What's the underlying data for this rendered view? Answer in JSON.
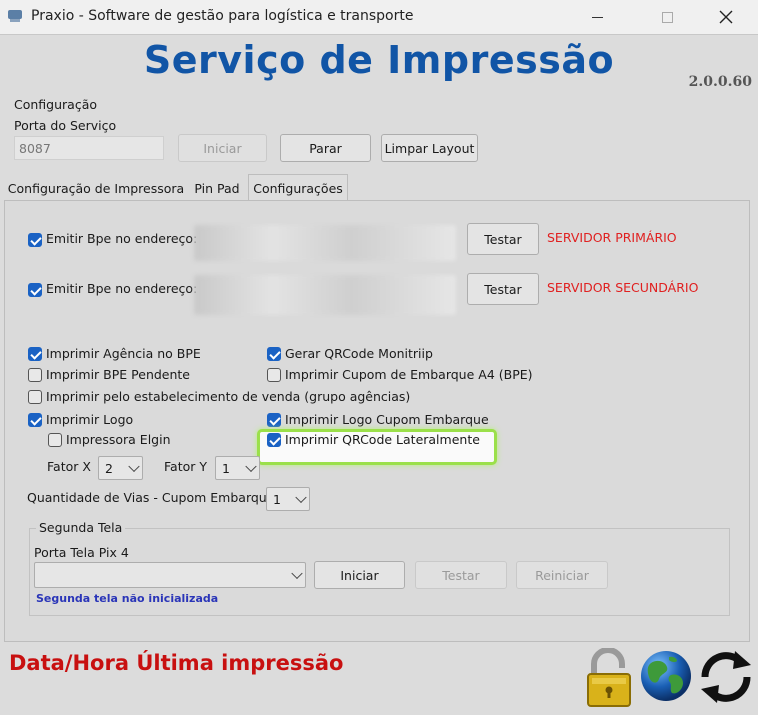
{
  "window": {
    "title": "Praxio - Software de gestão para logística e transporte",
    "minimize_icon": "minimize-icon",
    "maximize_icon": "maximize-icon",
    "close_icon": "close-icon"
  },
  "header": {
    "title": "Serviço de Impressão",
    "version": "2.0.0.60"
  },
  "config": {
    "group_label": "Configuração",
    "port_label": "Porta do Serviço",
    "port_value": "8087",
    "start_button": "Iniciar",
    "stop_button": "Parar",
    "clear_layout_button": "Limpar Layout"
  },
  "tabs": [
    {
      "label": "Configuração de Impressora",
      "active": false
    },
    {
      "label": "Pin Pad",
      "active": false
    },
    {
      "label": "Configurações",
      "active": true
    }
  ],
  "servers": [
    {
      "label": "Emitir Bpe no endereço:",
      "checked": true,
      "test_button": "Testar",
      "status": "SERVIDOR PRIMÁRIO"
    },
    {
      "label": "Emitir Bpe no endereço:",
      "checked": true,
      "test_button": "Testar",
      "status": "SERVIDOR SECUNDÁRIO"
    }
  ],
  "options": {
    "imprimir_agencia": {
      "label": "Imprimir Agência no BPE",
      "checked": true
    },
    "imprimir_pendente": {
      "label": "Imprimir BPE Pendente",
      "checked": false
    },
    "imprimir_estabelecimento": {
      "label": "Imprimir pelo estabelecimento de venda (grupo agências)",
      "checked": false
    },
    "imprimir_logo": {
      "label": "Imprimir Logo",
      "checked": true
    },
    "impressora_elgin": {
      "label": "Impressora Elgin",
      "checked": false
    },
    "gerar_qrcode": {
      "label": "Gerar QRCode Monitriip",
      "checked": true
    },
    "imprimir_cupom_a4": {
      "label": "Imprimir Cupom de Embarque A4 (BPE)",
      "checked": false
    },
    "imprimir_logo_cupom": {
      "label": "Imprimir Logo Cupom Embarque",
      "checked": true
    },
    "imprimir_qrcode_lateral": {
      "label": "Imprimir QRCode Lateralmente",
      "checked": true
    }
  },
  "factors": {
    "fator_x_label": "Fator X",
    "fator_x_value": "2",
    "fator_y_label": "Fator Y",
    "fator_y_value": "1"
  },
  "vias": {
    "label": "Quantidade de Vias - Cupom Embarque",
    "value": "1"
  },
  "segunda_tela": {
    "group_label": "Segunda Tela",
    "port_label": "Porta Tela Pix 4",
    "port_value": "",
    "start_button": "Iniciar",
    "test_button": "Testar",
    "restart_button": "Reiniciar",
    "status_text": "Segunda tela não inicializada"
  },
  "footer": {
    "last_print_label": "Data/Hora Última impressão",
    "lock_icon": "padlock-open-icon",
    "globe_icon": "globe-icon",
    "refresh_icon": "refresh-icon"
  },
  "colors": {
    "accent_blue": "#1155a6",
    "status_red": "#e02020",
    "footer_red": "#c81010",
    "highlight_green": "#9be04a",
    "checkbox_blue": "#1a62c4"
  }
}
